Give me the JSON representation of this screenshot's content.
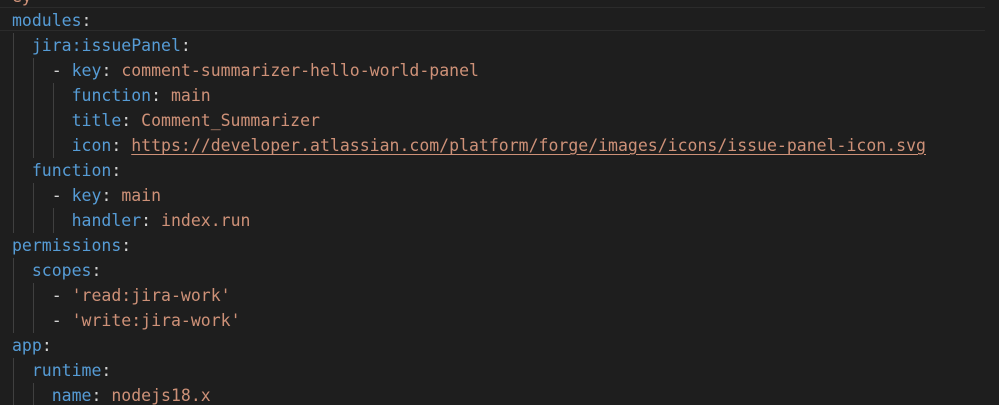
{
  "editor": {
    "cutoff_text": "ey",
    "lines": [
      {
        "indent": "",
        "dash": "",
        "key": "modules",
        "colon": ":",
        "value": "",
        "value_type": ""
      },
      {
        "indent": "  ",
        "dash": "",
        "key": "jira:issuePanel",
        "colon": ":",
        "value": "",
        "value_type": ""
      },
      {
        "indent": "    ",
        "dash": "- ",
        "key": "key",
        "colon": ": ",
        "value": "comment-summarizer-hello-world-panel",
        "value_type": "str"
      },
      {
        "indent": "      ",
        "dash": "",
        "key": "function",
        "colon": ": ",
        "value": "main",
        "value_type": "str"
      },
      {
        "indent": "      ",
        "dash": "",
        "key": "title",
        "colon": ": ",
        "value": "Comment_Summarizer",
        "value_type": "str"
      },
      {
        "indent": "      ",
        "dash": "",
        "key": "icon",
        "colon": ": ",
        "value": "https://developer.atlassian.com/platform/forge/images/icons/issue-panel-icon.svg",
        "value_type": "link"
      },
      {
        "indent": "  ",
        "dash": "",
        "key": "function",
        "colon": ":",
        "value": "",
        "value_type": ""
      },
      {
        "indent": "    ",
        "dash": "- ",
        "key": "key",
        "colon": ": ",
        "value": "main",
        "value_type": "str"
      },
      {
        "indent": "      ",
        "dash": "",
        "key": "handler",
        "colon": ": ",
        "value": "index.run",
        "value_type": "str"
      },
      {
        "indent": "",
        "dash": "",
        "key": "permissions",
        "colon": ":",
        "value": "",
        "value_type": ""
      },
      {
        "indent": "  ",
        "dash": "",
        "key": "scopes",
        "colon": ":",
        "value": "",
        "value_type": ""
      },
      {
        "indent": "    ",
        "dash": "- ",
        "key": "",
        "colon": "",
        "value": "'read:jira-work'",
        "value_type": "str"
      },
      {
        "indent": "    ",
        "dash": "- ",
        "key": "",
        "colon": "",
        "value": "'write:jira-work'",
        "value_type": "str"
      },
      {
        "indent": "",
        "dash": "",
        "key": "app",
        "colon": ":",
        "value": "",
        "value_type": ""
      },
      {
        "indent": "  ",
        "dash": "",
        "key": "runtime",
        "colon": ":",
        "value": "",
        "value_type": ""
      },
      {
        "indent": "    ",
        "dash": "",
        "key": "name",
        "colon": ": ",
        "value": "nodejs18.x",
        "value_type": "str"
      }
    ]
  }
}
